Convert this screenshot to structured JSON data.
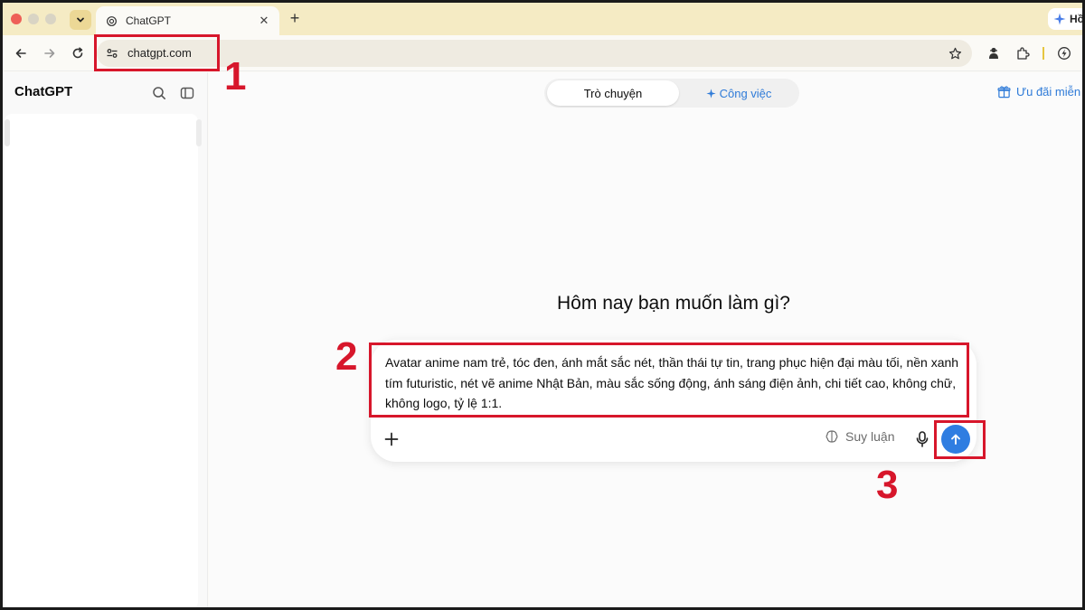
{
  "browser": {
    "tab_title": "ChatGPT",
    "tab_close": "✕",
    "new_tab": "+",
    "url": "chatgpt.com",
    "profile_label": "Hồ",
    "accent_color": "#f5ebc4"
  },
  "sidebar": {
    "title": "ChatGPT"
  },
  "main": {
    "tabs": [
      {
        "label": "Trò chuyện",
        "active": true
      },
      {
        "label": "Công việc",
        "active": false
      }
    ],
    "promo_label": "Ưu đãi miễn p",
    "headline": "Hôm nay bạn muốn làm gì?"
  },
  "composer": {
    "prompt_text": "Avatar anime nam trẻ, tóc đen, ánh mắt sắc nét, thần thái tự tin, trang phục hiện đại màu tối, nền xanh tím futuristic, nét vẽ anime Nhật Bản, màu sắc sống động, ánh sáng điện ảnh, chi tiết cao, không chữ, không logo, tỷ lệ 1:1.",
    "reason_label": "Suy luận",
    "send_color": "#2f7de1"
  },
  "annotations": {
    "color": "#d7162b",
    "labels": [
      "1",
      "2",
      "3"
    ]
  }
}
